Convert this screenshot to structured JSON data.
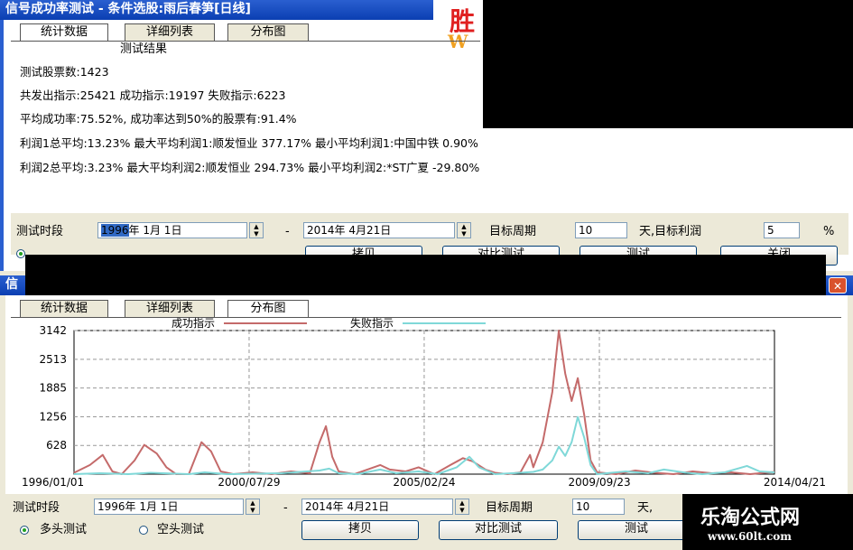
{
  "top_window": {
    "title": "信号成功率测试 - 条件选股:雨后春笋[日线]",
    "tabs": [
      "统计数据",
      "详细列表",
      "分布图"
    ],
    "results_heading": "测试结果",
    "stats": [
      "测试股票数:1423",
      "共发出指示:25421  成功指示:19197  失败指示:6223",
      "平均成功率:75.52%,  成功率达到50%的股票有:91.4%",
      "利润1总平均:13.23%  最大平均利润1:顺发恒业  377.17%  最小平均利润1:中国中铁  0.90%",
      "利润2总平均:3.23%  最大平均利润2:顺发恒业  294.73%  最小平均利润2:*ST广夏   -29.80%"
    ],
    "period_label": "测试时段",
    "start_date": "1996年  1月  1日",
    "start_year_selected": "1996",
    "dash": "-",
    "end_date": "2014年  4月21日",
    "target_period_label": "目标周期",
    "target_period_value": "10",
    "day_unit": "天,目标利润",
    "target_profit_value": "5",
    "percent": "%",
    "buttons_partial": [
      "拷贝",
      "对比测试",
      "测试",
      "关闭"
    ]
  },
  "overlay_logo_partial": {
    "big": "胜",
    "small": "W"
  },
  "bottom_window": {
    "title_partial": "信",
    "close_glyph": "✕",
    "tabs": [
      "统计数据",
      "详细列表",
      "分布图"
    ],
    "legend": [
      {
        "name": "成功指示",
        "color": "#c46a6a"
      },
      {
        "name": "失败指示",
        "color": "#7fd8d8"
      }
    ],
    "period_label": "测试时段",
    "start_date": "1996年  1月  1日",
    "dash": "-",
    "end_date": "2014年  4月21日",
    "target_period_label": "目标周期",
    "target_period_value": "10",
    "day_unit_partial": "天,",
    "radio_long": "多头测试",
    "radio_short": "空头测试",
    "buttons": [
      "拷贝",
      "对比测试",
      "测试"
    ]
  },
  "watermark": {
    "title": "乐淘公式网",
    "url": "www.60lt.com"
  },
  "chart_data": {
    "type": "line",
    "ylim": [
      0,
      3142
    ],
    "y_ticks": [
      "3142",
      "2513",
      "1885",
      "1256",
      "628"
    ],
    "x_ticks": [
      "1996/01/01",
      "2000/07/29",
      "2005/02/24",
      "2009/09/23",
      "2014/04/21"
    ],
    "x_range": [
      "1996/01/01",
      "2014/04/21"
    ],
    "grid": true,
    "legend_position": "top",
    "series": [
      {
        "name": "成功指示",
        "color": "#c46a6a",
        "points": [
          [
            "1996/01/01",
            30
          ],
          [
            "1996/06/01",
            200
          ],
          [
            "1996/10/01",
            420
          ],
          [
            "1997/01/01",
            60
          ],
          [
            "1997/04/01",
            0
          ],
          [
            "1997/08/01",
            300
          ],
          [
            "1997/11/01",
            640
          ],
          [
            "1998/03/01",
            450
          ],
          [
            "1998/06/01",
            150
          ],
          [
            "1998/09/01",
            0
          ],
          [
            "1999/01/01",
            0
          ],
          [
            "1999/05/01",
            700
          ],
          [
            "1999/08/01",
            500
          ],
          [
            "1999/11/01",
            60
          ],
          [
            "2000/03/01",
            0
          ],
          [
            "2000/09/01",
            40
          ],
          [
            "2001/03/01",
            0
          ],
          [
            "2001/09/01",
            60
          ],
          [
            "2002/03/01",
            20
          ],
          [
            "2002/06/01",
            700
          ],
          [
            "2002/08/01",
            1050
          ],
          [
            "2002/10/01",
            380
          ],
          [
            "2002/12/01",
            60
          ],
          [
            "2003/05/01",
            0
          ],
          [
            "2003/09/01",
            100
          ],
          [
            "2004/01/01",
            200
          ],
          [
            "2004/04/01",
            100
          ],
          [
            "2004/09/01",
            60
          ],
          [
            "2005/01/01",
            150
          ],
          [
            "2005/06/01",
            0
          ],
          [
            "2005/11/01",
            200
          ],
          [
            "2006/03/01",
            350
          ],
          [
            "2006/06/01",
            280
          ],
          [
            "2006/10/01",
            100
          ],
          [
            "2007/01/01",
            30
          ],
          [
            "2007/05/01",
            0
          ],
          [
            "2007/09/01",
            40
          ],
          [
            "2007/12/01",
            420
          ],
          [
            "2008/01/01",
            150
          ],
          [
            "2008/04/01",
            700
          ],
          [
            "2008/07/01",
            1800
          ],
          [
            "2008/09/01",
            3142
          ],
          [
            "2008/11/01",
            2200
          ],
          [
            "2009/01/01",
            1600
          ],
          [
            "2009/03/01",
            2100
          ],
          [
            "2009/05/01",
            1300
          ],
          [
            "2009/07/01",
            300
          ],
          [
            "2009/09/01",
            40
          ],
          [
            "2010/03/01",
            0
          ],
          [
            "2010/09/01",
            80
          ],
          [
            "2011/03/01",
            30
          ],
          [
            "2011/09/01",
            0
          ],
          [
            "2012/03/01",
            60
          ],
          [
            "2012/09/01",
            20
          ],
          [
            "2013/03/01",
            40
          ],
          [
            "2013/09/01",
            0
          ],
          [
            "2014/04/21",
            50
          ]
        ]
      },
      {
        "name": "失败指示",
        "color": "#7fd8d8",
        "points": [
          [
            "1996/01/01",
            0
          ],
          [
            "1996/09/01",
            20
          ],
          [
            "1997/06/01",
            0
          ],
          [
            "1998/01/01",
            30
          ],
          [
            "1999/01/01",
            0
          ],
          [
            "1999/06/01",
            40
          ],
          [
            "2000/01/01",
            0
          ],
          [
            "2001/06/01",
            20
          ],
          [
            "2002/06/01",
            80
          ],
          [
            "2002/09/01",
            120
          ],
          [
            "2002/12/01",
            20
          ],
          [
            "2003/06/01",
            0
          ],
          [
            "2004/01/01",
            100
          ],
          [
            "2004/06/01",
            20
          ],
          [
            "2005/01/01",
            60
          ],
          [
            "2005/07/01",
            0
          ],
          [
            "2006/01/01",
            150
          ],
          [
            "2006/05/01",
            380
          ],
          [
            "2006/08/01",
            150
          ],
          [
            "2007/01/01",
            0
          ],
          [
            "2007/09/01",
            30
          ],
          [
            "2008/01/01",
            50
          ],
          [
            "2008/04/01",
            100
          ],
          [
            "2008/07/01",
            300
          ],
          [
            "2008/09/01",
            600
          ],
          [
            "2008/11/01",
            400
          ],
          [
            "2009/01/01",
            700
          ],
          [
            "2009/03/01",
            1250
          ],
          [
            "2009/05/01",
            800
          ],
          [
            "2009/07/01",
            200
          ],
          [
            "2009/09/01",
            0
          ],
          [
            "2010/06/01",
            60
          ],
          [
            "2011/01/01",
            20
          ],
          [
            "2011/06/01",
            100
          ],
          [
            "2012/01/01",
            30
          ],
          [
            "2012/06/01",
            0
          ],
          [
            "2013/01/01",
            40
          ],
          [
            "2013/08/01",
            180
          ],
          [
            "2013/12/01",
            60
          ],
          [
            "2014/04/21",
            40
          ]
        ]
      }
    ]
  }
}
